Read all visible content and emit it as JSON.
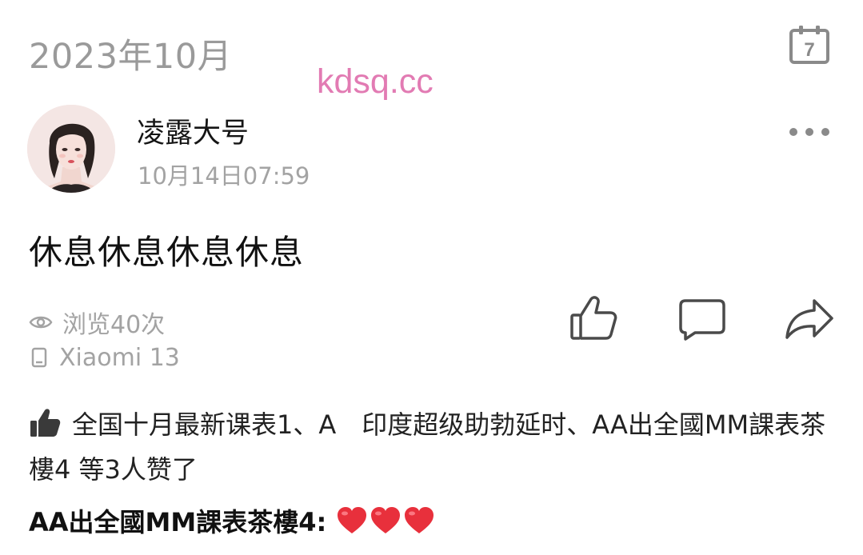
{
  "header": {
    "month_title": "2023年10月",
    "calendar_day": "7",
    "calendar_icon": "calendar-icon"
  },
  "watermark": "kdsq.cc",
  "post": {
    "author_name": "凌露大号",
    "time": "10月14日07:59",
    "text": "休息休息休息休息",
    "more_icon": "more-dots-icon"
  },
  "meta": {
    "views": "浏览40次",
    "device": "Xiaomi 13",
    "views_icon": "eye-icon",
    "device_icon": "phone-icon"
  },
  "actions": {
    "like_icon": "thumbs-up-icon",
    "comment_icon": "comment-icon",
    "share_icon": "share-icon"
  },
  "likes": {
    "text": "全国十月最新课表1、A　印度超级助勃延时、AA出全國MM課表茶樓4 等3人赞了"
  },
  "comment": {
    "author": "AA出全國MM課表茶樓4:",
    "hearts": 3
  },
  "colors": {
    "gray_text": "#a3a3a3",
    "watermark": "#e27bb3",
    "heart": "#e8303c"
  }
}
